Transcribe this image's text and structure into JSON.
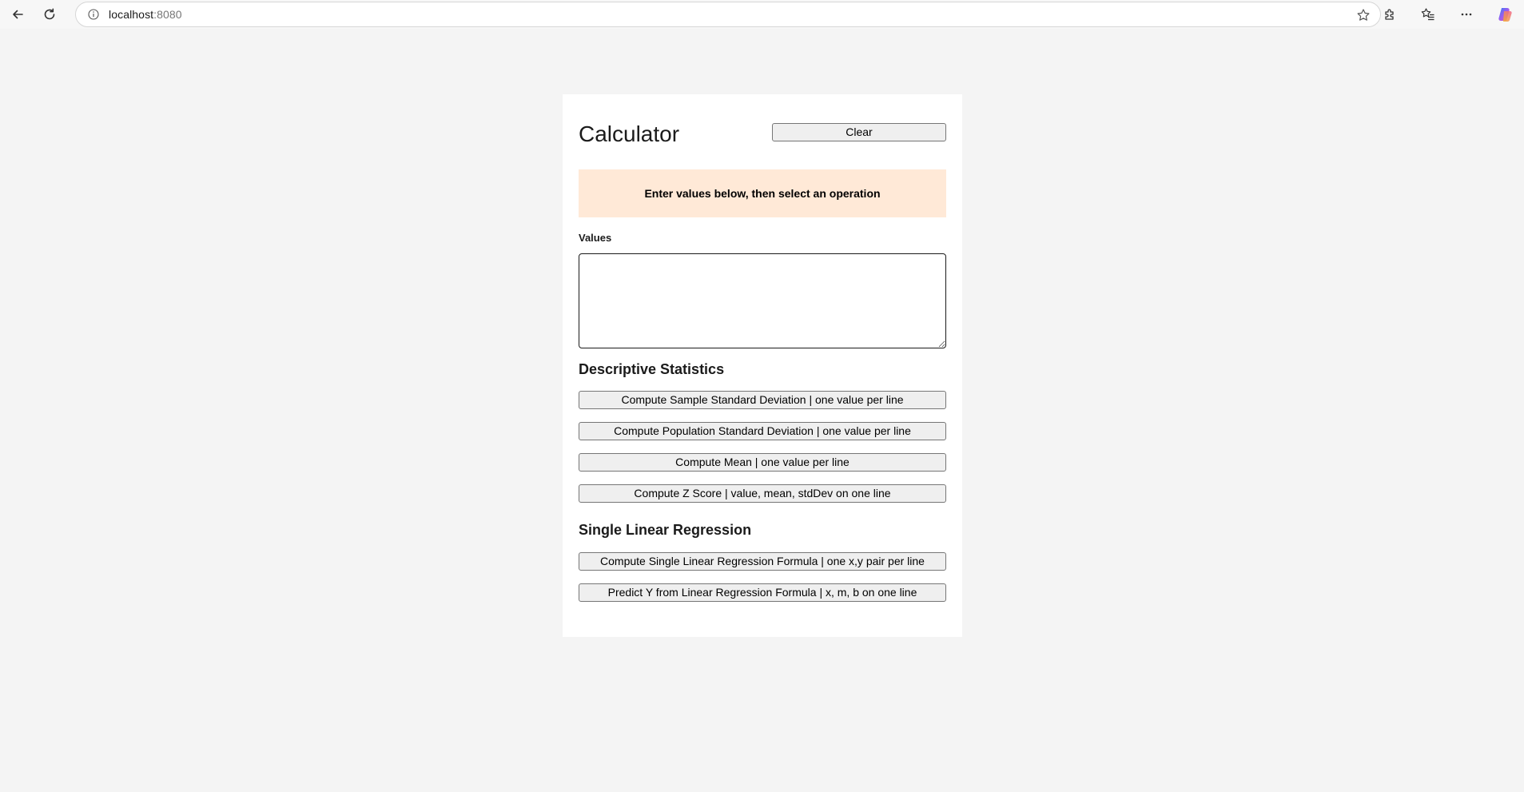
{
  "browser": {
    "url_host": "localhost",
    "url_port": ":8080"
  },
  "page": {
    "title": "Calculator",
    "clear_label": "Clear",
    "notice": "Enter values below, then select an operation",
    "values_label": "Values",
    "values_input": ""
  },
  "sections": {
    "descriptive": {
      "heading": "Descriptive Statistics",
      "buttons": [
        "Compute Sample Standard Deviation | one value per line",
        "Compute Population Standard Deviation | one value per line",
        "Compute Mean | one value per line",
        "Compute Z Score | value, mean, stdDev on one line"
      ]
    },
    "regression": {
      "heading": "Single Linear Regression",
      "buttons": [
        "Compute Single Linear Regression Formula | one x,y pair per line",
        "Predict Y from Linear Regression Formula | x, m, b on one line"
      ]
    }
  }
}
